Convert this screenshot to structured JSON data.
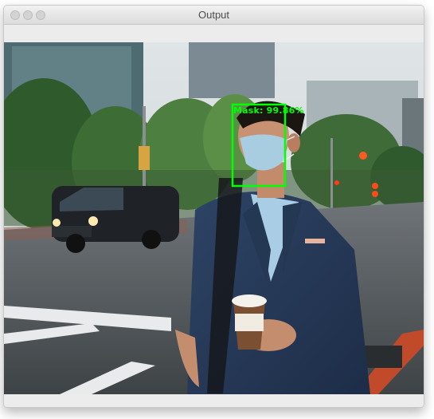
{
  "window": {
    "title": "Output"
  },
  "detection": {
    "label": "Mask: 99.86%",
    "box_color": "#00ff00"
  },
  "image": {
    "description_icon": "photo-icon"
  }
}
